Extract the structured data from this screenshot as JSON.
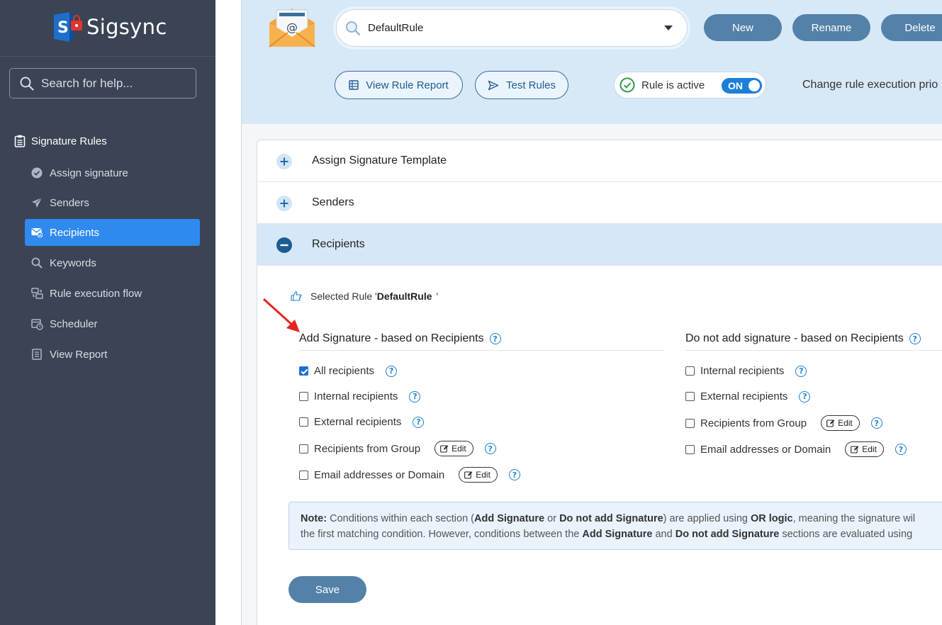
{
  "brand": {
    "name": "Sigsync"
  },
  "sidebar": {
    "search_placeholder": "Search for help...",
    "section_title": "Signature Rules",
    "items": [
      {
        "label": "Assign signature",
        "icon": "check-circle-icon"
      },
      {
        "label": "Senders",
        "icon": "send-icon"
      },
      {
        "label": "Recipients",
        "icon": "mail-check-icon",
        "active": true
      },
      {
        "label": "Keywords",
        "icon": "magnifier-icon"
      },
      {
        "label": "Rule execution flow",
        "icon": "flow-icon"
      },
      {
        "label": "Scheduler",
        "icon": "calendar-clock-icon"
      },
      {
        "label": "View Report",
        "icon": "report-icon"
      }
    ]
  },
  "toolbar": {
    "rule_name": "DefaultRule",
    "new_label": "New",
    "rename_label": "Rename",
    "delete_label": "Delete",
    "view_report_label": "View Rule Report",
    "test_rules_label": "Test Rules",
    "rule_active_label": "Rule is active",
    "toggle_state": "ON",
    "priority_text": "Change rule execution prio"
  },
  "accordion": {
    "assign_template": "Assign Signature Template",
    "senders": "Senders",
    "recipients": "Recipients"
  },
  "recipients": {
    "selected_prefix": "Selected Rule '",
    "selected_rule": "DefaultRule",
    "selected_suffix": "'",
    "add_title": "Add Signature - based on Recipients",
    "add_options": [
      {
        "label": "All recipients",
        "checked": true
      },
      {
        "label": "Internal recipients",
        "checked": false
      },
      {
        "label": "External recipients",
        "checked": false
      },
      {
        "label": "Recipients from Group",
        "checked": false,
        "edit": "Edit"
      },
      {
        "label": "Email addresses or Domain",
        "checked": false,
        "edit": "Edit"
      }
    ],
    "noadd_title": "Do not add signature - based on Recipients",
    "noadd_options": [
      {
        "label": "Internal recipients",
        "checked": false
      },
      {
        "label": "External recipients",
        "checked": false
      },
      {
        "label": "Recipients from Group",
        "checked": false,
        "edit": "Edit"
      },
      {
        "label": "Email addresses or Domain",
        "checked": false,
        "edit": "Edit"
      }
    ],
    "note": {
      "label": "Note:",
      "t1": " Conditions within each section (",
      "b1": "Add Signature",
      "t2": " or ",
      "b2": "Do not add Signature",
      "t3": ") are applied using ",
      "b3": "OR logic",
      "t4": ", meaning the signature wil",
      "t5": "the first matching condition. However, conditions between the ",
      "b4": "Add Signature",
      "t6": " and ",
      "b5": "Do not add Signature",
      "t7": " sections are evaluated using"
    },
    "save_label": "Save"
  },
  "colors": {
    "sidebar": "#3b4454",
    "accent": "#2f8af0",
    "button": "#5381a8",
    "band": "#d7e8f7"
  }
}
